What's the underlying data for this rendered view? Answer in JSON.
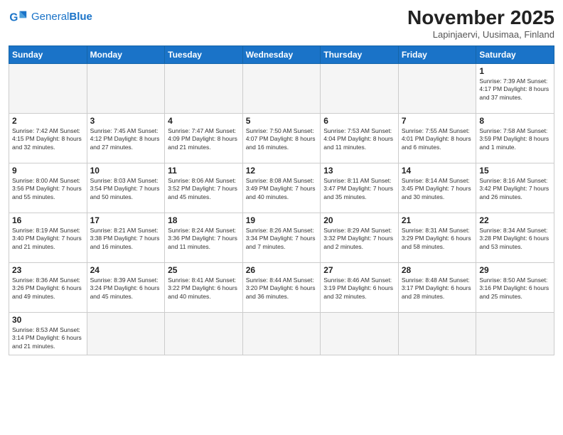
{
  "header": {
    "logo_general": "General",
    "logo_blue": "Blue",
    "month_title": "November 2025",
    "location": "Lapinjaervi, Uusimaa, Finland"
  },
  "weekdays": [
    "Sunday",
    "Monday",
    "Tuesday",
    "Wednesday",
    "Thursday",
    "Friday",
    "Saturday"
  ],
  "days": [
    {
      "num": "",
      "info": "",
      "empty": true
    },
    {
      "num": "",
      "info": "",
      "empty": true
    },
    {
      "num": "",
      "info": "",
      "empty": true
    },
    {
      "num": "",
      "info": "",
      "empty": true
    },
    {
      "num": "",
      "info": "",
      "empty": true
    },
    {
      "num": "",
      "info": "",
      "empty": true
    },
    {
      "num": "1",
      "info": "Sunrise: 7:39 AM\nSunset: 4:17 PM\nDaylight: 8 hours\nand 37 minutes."
    },
    {
      "num": "2",
      "info": "Sunrise: 7:42 AM\nSunset: 4:15 PM\nDaylight: 8 hours\nand 32 minutes."
    },
    {
      "num": "3",
      "info": "Sunrise: 7:45 AM\nSunset: 4:12 PM\nDaylight: 8 hours\nand 27 minutes."
    },
    {
      "num": "4",
      "info": "Sunrise: 7:47 AM\nSunset: 4:09 PM\nDaylight: 8 hours\nand 21 minutes."
    },
    {
      "num": "5",
      "info": "Sunrise: 7:50 AM\nSunset: 4:07 PM\nDaylight: 8 hours\nand 16 minutes."
    },
    {
      "num": "6",
      "info": "Sunrise: 7:53 AM\nSunset: 4:04 PM\nDaylight: 8 hours\nand 11 minutes."
    },
    {
      "num": "7",
      "info": "Sunrise: 7:55 AM\nSunset: 4:01 PM\nDaylight: 8 hours\nand 6 minutes."
    },
    {
      "num": "8",
      "info": "Sunrise: 7:58 AM\nSunset: 3:59 PM\nDaylight: 8 hours\nand 1 minute."
    },
    {
      "num": "9",
      "info": "Sunrise: 8:00 AM\nSunset: 3:56 PM\nDaylight: 7 hours\nand 55 minutes."
    },
    {
      "num": "10",
      "info": "Sunrise: 8:03 AM\nSunset: 3:54 PM\nDaylight: 7 hours\nand 50 minutes."
    },
    {
      "num": "11",
      "info": "Sunrise: 8:06 AM\nSunset: 3:52 PM\nDaylight: 7 hours\nand 45 minutes."
    },
    {
      "num": "12",
      "info": "Sunrise: 8:08 AM\nSunset: 3:49 PM\nDaylight: 7 hours\nand 40 minutes."
    },
    {
      "num": "13",
      "info": "Sunrise: 8:11 AM\nSunset: 3:47 PM\nDaylight: 7 hours\nand 35 minutes."
    },
    {
      "num": "14",
      "info": "Sunrise: 8:14 AM\nSunset: 3:45 PM\nDaylight: 7 hours\nand 30 minutes."
    },
    {
      "num": "15",
      "info": "Sunrise: 8:16 AM\nSunset: 3:42 PM\nDaylight: 7 hours\nand 26 minutes."
    },
    {
      "num": "16",
      "info": "Sunrise: 8:19 AM\nSunset: 3:40 PM\nDaylight: 7 hours\nand 21 minutes."
    },
    {
      "num": "17",
      "info": "Sunrise: 8:21 AM\nSunset: 3:38 PM\nDaylight: 7 hours\nand 16 minutes."
    },
    {
      "num": "18",
      "info": "Sunrise: 8:24 AM\nSunset: 3:36 PM\nDaylight: 7 hours\nand 11 minutes."
    },
    {
      "num": "19",
      "info": "Sunrise: 8:26 AM\nSunset: 3:34 PM\nDaylight: 7 hours\nand 7 minutes."
    },
    {
      "num": "20",
      "info": "Sunrise: 8:29 AM\nSunset: 3:32 PM\nDaylight: 7 hours\nand 2 minutes."
    },
    {
      "num": "21",
      "info": "Sunrise: 8:31 AM\nSunset: 3:29 PM\nDaylight: 6 hours\nand 58 minutes."
    },
    {
      "num": "22",
      "info": "Sunrise: 8:34 AM\nSunset: 3:28 PM\nDaylight: 6 hours\nand 53 minutes."
    },
    {
      "num": "23",
      "info": "Sunrise: 8:36 AM\nSunset: 3:26 PM\nDaylight: 6 hours\nand 49 minutes."
    },
    {
      "num": "24",
      "info": "Sunrise: 8:39 AM\nSunset: 3:24 PM\nDaylight: 6 hours\nand 45 minutes."
    },
    {
      "num": "25",
      "info": "Sunrise: 8:41 AM\nSunset: 3:22 PM\nDaylight: 6 hours\nand 40 minutes."
    },
    {
      "num": "26",
      "info": "Sunrise: 8:44 AM\nSunset: 3:20 PM\nDaylight: 6 hours\nand 36 minutes."
    },
    {
      "num": "27",
      "info": "Sunrise: 8:46 AM\nSunset: 3:19 PM\nDaylight: 6 hours\nand 32 minutes."
    },
    {
      "num": "28",
      "info": "Sunrise: 8:48 AM\nSunset: 3:17 PM\nDaylight: 6 hours\nand 28 minutes."
    },
    {
      "num": "29",
      "info": "Sunrise: 8:50 AM\nSunset: 3:16 PM\nDaylight: 6 hours\nand 25 minutes."
    },
    {
      "num": "30",
      "info": "Sunrise: 8:53 AM\nSunset: 3:14 PM\nDaylight: 6 hours\nand 21 minutes."
    },
    {
      "num": "",
      "info": "",
      "empty": true
    },
    {
      "num": "",
      "info": "",
      "empty": true
    },
    {
      "num": "",
      "info": "",
      "empty": true
    },
    {
      "num": "",
      "info": "",
      "empty": true
    },
    {
      "num": "",
      "info": "",
      "empty": true
    },
    {
      "num": "",
      "info": "",
      "empty": true
    }
  ]
}
